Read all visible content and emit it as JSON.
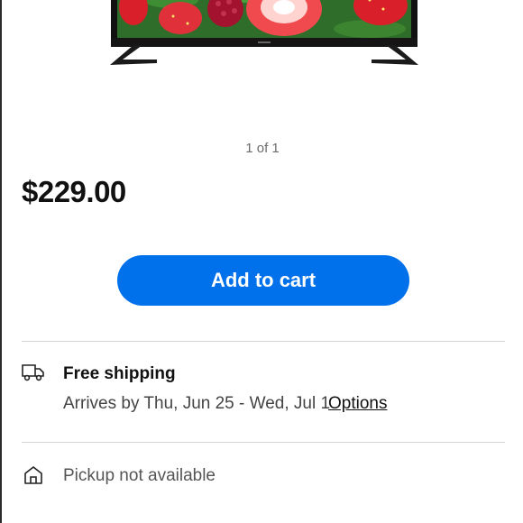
{
  "product": {
    "image_alt": "Television displaying strawberries and raspberries",
    "image_counter": "1 of 1",
    "price": "$229.00"
  },
  "actions": {
    "add_to_cart_label": "Add to cart"
  },
  "shipping": {
    "icon": "truck-icon",
    "title": "Free shipping",
    "arrival": "Arrives by Thu, Jun 25 - Wed, Jul 1",
    "options_label": "Options"
  },
  "pickup": {
    "icon": "store-icon",
    "text": "Pickup not available"
  },
  "colors": {
    "accent": "#0071ea",
    "divider": "#d8d8d8"
  }
}
